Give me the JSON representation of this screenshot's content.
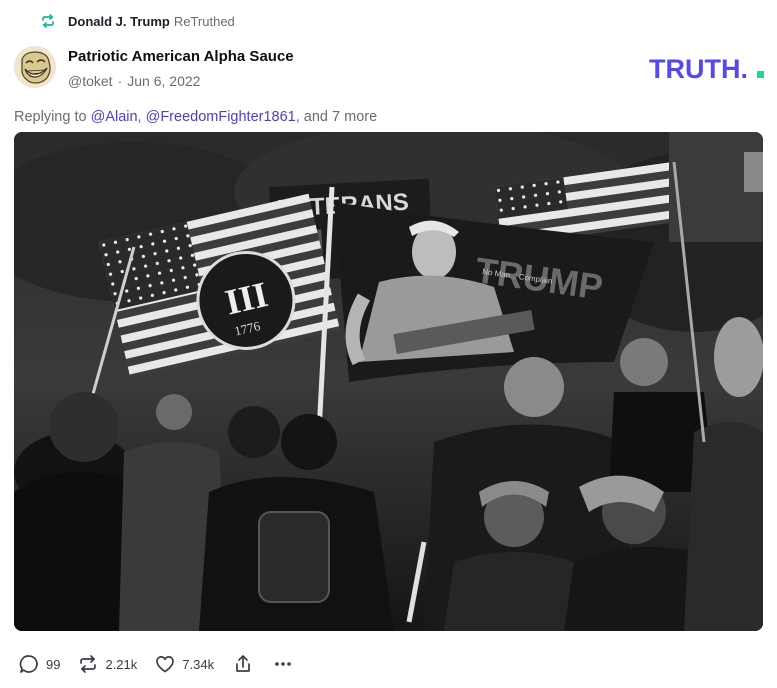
{
  "retruth": {
    "icon": "retruth-icon",
    "author": "Donald J. Trump",
    "label": "ReTruthed"
  },
  "post": {
    "display_name": "Patriotic American Alpha Sauce",
    "handle": "@toket",
    "separator": "·",
    "date": "Jun 6, 2022",
    "reply_prefix": "Replying to",
    "mentions": [
      "@Alain",
      "@FreedomFighter1861"
    ],
    "reply_suffix": ", and 7 more",
    "image_texts": {
      "banner_left": "VETERANS",
      "flag_main": "TRUMP",
      "flag_tagline": "No Man... Complain",
      "three_percent": "III",
      "year": "1776"
    }
  },
  "brand": {
    "logo_text": "TRUTH.",
    "color": "#5448ee",
    "accent": "#14d9a5"
  },
  "actions": {
    "replies": {
      "icon": "reply-icon",
      "count": "99"
    },
    "retruths": {
      "icon": "retruth-icon",
      "count": "2.21k"
    },
    "likes": {
      "icon": "heart-icon",
      "count": "7.34k"
    },
    "share": {
      "icon": "share-icon"
    },
    "more": {
      "icon": "more-icon"
    }
  }
}
